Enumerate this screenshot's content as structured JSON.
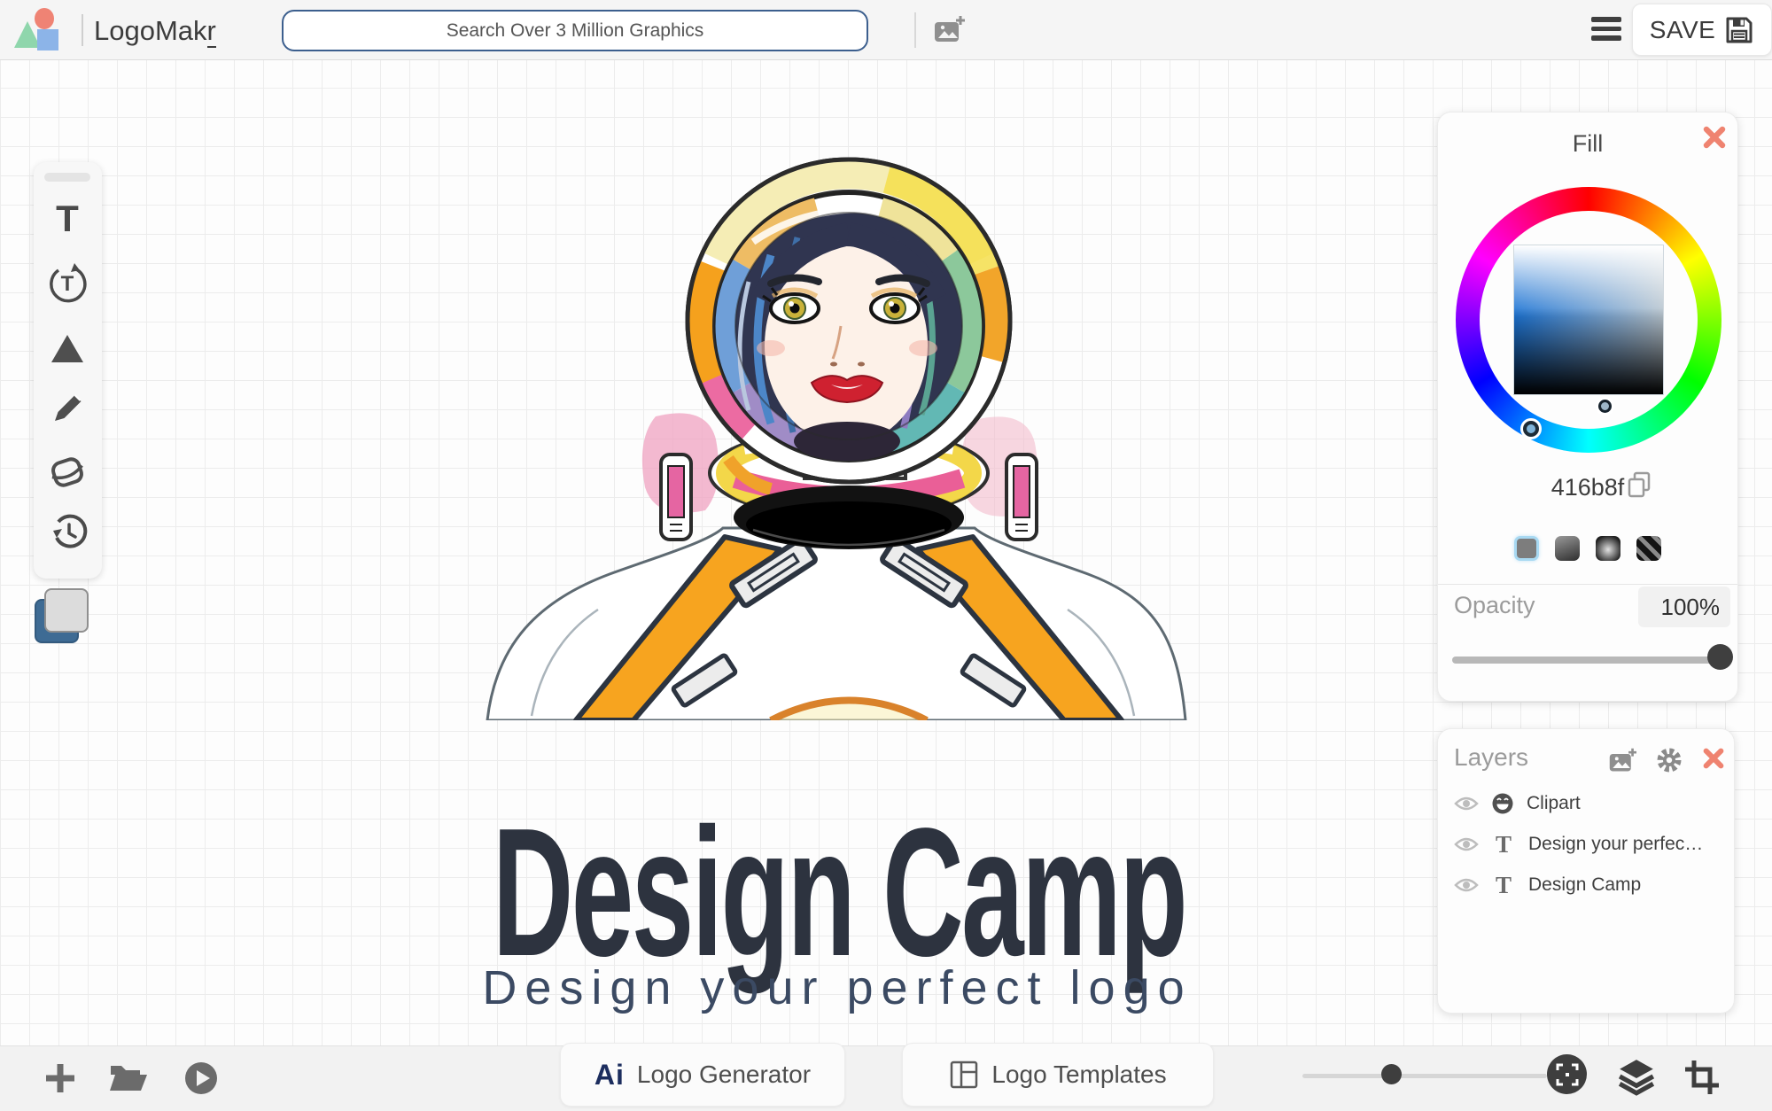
{
  "topbar": {
    "brand_prefix": "LogoMak",
    "brand_suffix": "r",
    "search_placeholder": "Search Over 3 Million Graphics",
    "save_label": "SAVE"
  },
  "toolbar": {
    "text_tool_glyph": "T",
    "curved_text_glyph": "T"
  },
  "canvas": {
    "title": "Design Camp",
    "subtitle": "Design your perfect logo"
  },
  "fill_panel": {
    "title": "Fill",
    "hex": "416b8f",
    "opacity_label": "Opacity",
    "opacity_value": "100%"
  },
  "layers_panel": {
    "title": "Layers",
    "text_icon_glyph": "T",
    "layers": [
      {
        "name": "Clipart"
      },
      {
        "name": "Design your perfec…"
      },
      {
        "name": "Design Camp"
      }
    ]
  },
  "bottombar": {
    "ai_glyph": "Ai",
    "logo_generator_label": "Logo Generator",
    "logo_templates_label": "Logo Templates"
  },
  "colors": {
    "fill_hex": "#416b8f",
    "close_accent": "#ef8370",
    "selected_swatch_border": "#a8d9f2"
  }
}
